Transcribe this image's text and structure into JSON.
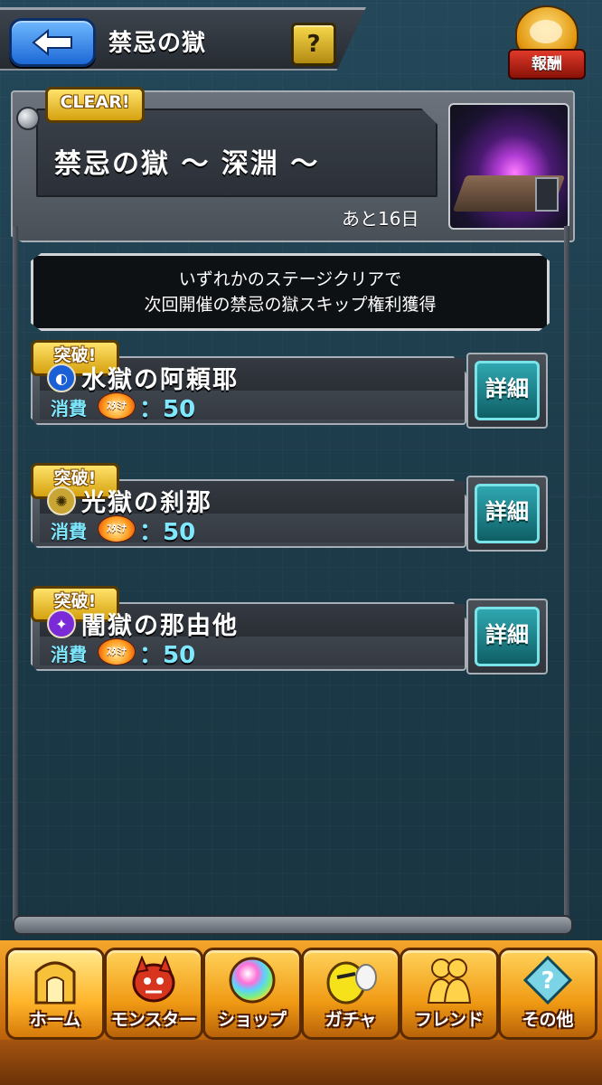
{
  "header": {
    "title": "禁忌の獄",
    "help_label": "?",
    "reward_label": "報酬"
  },
  "banner": {
    "clear_badge": "CLEAR!",
    "dungeon_name": "禁忌の獄 ～ 深淵 ～",
    "remaining": "あと16日"
  },
  "info": {
    "line1": "いずれかのステージクリアで",
    "line2": "次回開催の禁忌の獄スキップ権利獲得"
  },
  "stages": [
    {
      "badge": "突破!",
      "name": "水獄の阿頼耶",
      "cost_label": "消費",
      "stamina_label": "ｽﾀﾐﾅ",
      "cost": "：50",
      "detail": "詳細",
      "element_color": "#1a5fd6",
      "element_icon": "water-element-icon",
      "element_glyph": "◐"
    },
    {
      "badge": "突破!",
      "name": "光獄の刹那",
      "cost_label": "消費",
      "stamina_label": "ｽﾀﾐﾅ",
      "cost": "：50",
      "detail": "詳細",
      "element_color": "#c9a633",
      "element_icon": "light-element-icon",
      "element_glyph": "✺"
    },
    {
      "badge": "突破!",
      "name": "闇獄の那由他",
      "cost_label": "消費",
      "stamina_label": "ｽﾀﾐﾅ",
      "cost": "：50",
      "detail": "詳細",
      "element_color": "#7a2ad6",
      "element_icon": "dark-element-icon",
      "element_glyph": "✦"
    }
  ],
  "nav": [
    {
      "label": "ホーム",
      "icon": "home-icon"
    },
    {
      "label": "モンスター",
      "icon": "monster-icon"
    },
    {
      "label": "ショップ",
      "icon": "shop-icon"
    },
    {
      "label": "ガチャ",
      "icon": "gacha-icon"
    },
    {
      "label": "フレンド",
      "icon": "friend-icon"
    },
    {
      "label": "その他",
      "icon": "other-icon"
    }
  ]
}
